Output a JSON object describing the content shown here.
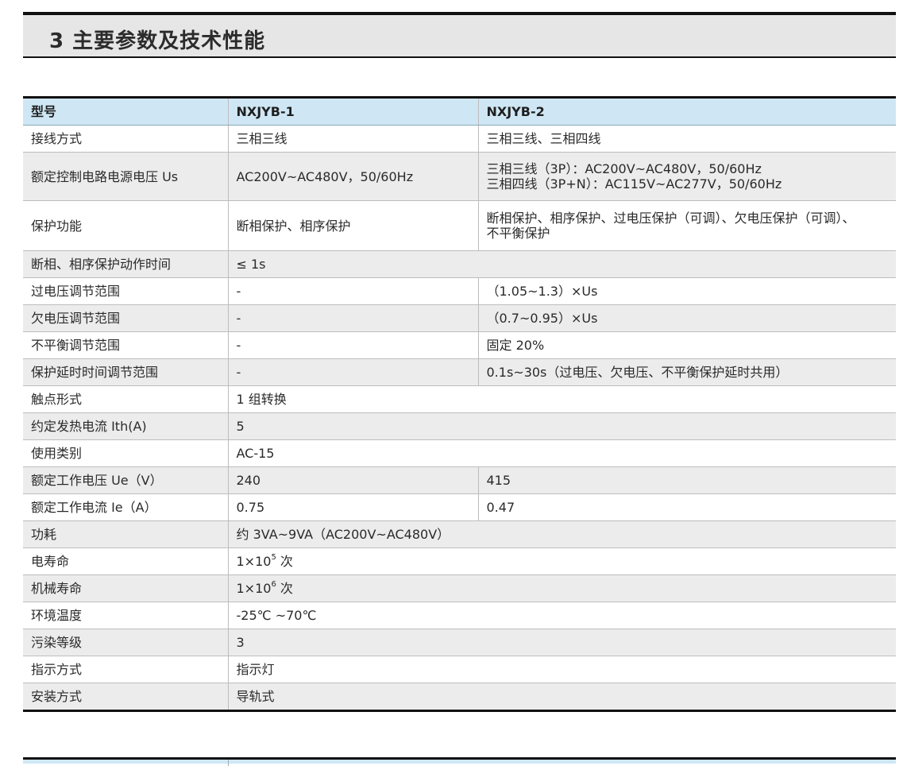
{
  "section": {
    "title": "3 主要参数及技术性能"
  },
  "table": {
    "headers": [
      "型号",
      "NXJYB-1",
      "NXJYB-2"
    ],
    "rows": {
      "wiring": {
        "label": "接线方式",
        "v1": "三相三线",
        "v2": "三相三线、三相四线"
      },
      "us": {
        "label": "额定控制电路电源电压 Us",
        "v1": "AC200V~AC480V，50/60Hz",
        "v2_line1": "三相三线（3P）：AC200V~AC480V，50/60Hz",
        "v2_line2": "三相四线（3P+N）：AC115V~AC277V，50/60Hz"
      },
      "protect": {
        "label": "保护功能",
        "v1": "断相保护、相序保护",
        "v2_line1": "断相保护、相序保护、过电压保护（可调）、欠电压保护（可调）、",
        "v2_line2": "不平衡保护"
      },
      "action_time": {
        "label": "断相、相序保护动作时间",
        "v": "≤ 1s"
      },
      "over_v": {
        "label": "过电压调节范围",
        "v1": "-",
        "v2": "（1.05~1.3）×Us"
      },
      "under_v": {
        "label": "欠电压调节范围",
        "v1": "-",
        "v2": "（0.7~0.95）×Us"
      },
      "unbalance": {
        "label": "不平衡调节范围",
        "v1": "-",
        "v2": "固定 20%"
      },
      "delay": {
        "label": "保护延时时间调节范围",
        "v1": "-",
        "v2": "0.1s~30s（过电压、欠电压、不平衡保护延时共用）"
      },
      "contact": {
        "label": "触点形式",
        "v": "1 组转换"
      },
      "ith": {
        "label": "约定发热电流 Ith(A)",
        "v": "5"
      },
      "category": {
        "label": "使用类别",
        "v": "AC-15"
      },
      "ue": {
        "label": "额定工作电压 Ue（V）",
        "v1": "240",
        "v2": "415"
      },
      "ie": {
        "label": "额定工作电流 Ie（A）",
        "v1": "0.75",
        "v2": "0.47"
      },
      "power": {
        "label": "功耗",
        "v": "约 3VA~9VA（AC200V~AC480V）"
      },
      "elec_life": {
        "label": "电寿命",
        "base": "1×10",
        "exp": "5",
        "unit": " 次"
      },
      "mech_life": {
        "label": "机械寿命",
        "base": "1×10",
        "exp": "6",
        "unit": " 次"
      },
      "temp": {
        "label": "环境温度",
        "v": "-25℃ ~70℃"
      },
      "pollution": {
        "label": "污染等级",
        "v": "3"
      },
      "indicator": {
        "label": "指示方式",
        "v": "指示灯"
      },
      "mount": {
        "label": "安装方式",
        "v": "导轨式"
      }
    }
  }
}
